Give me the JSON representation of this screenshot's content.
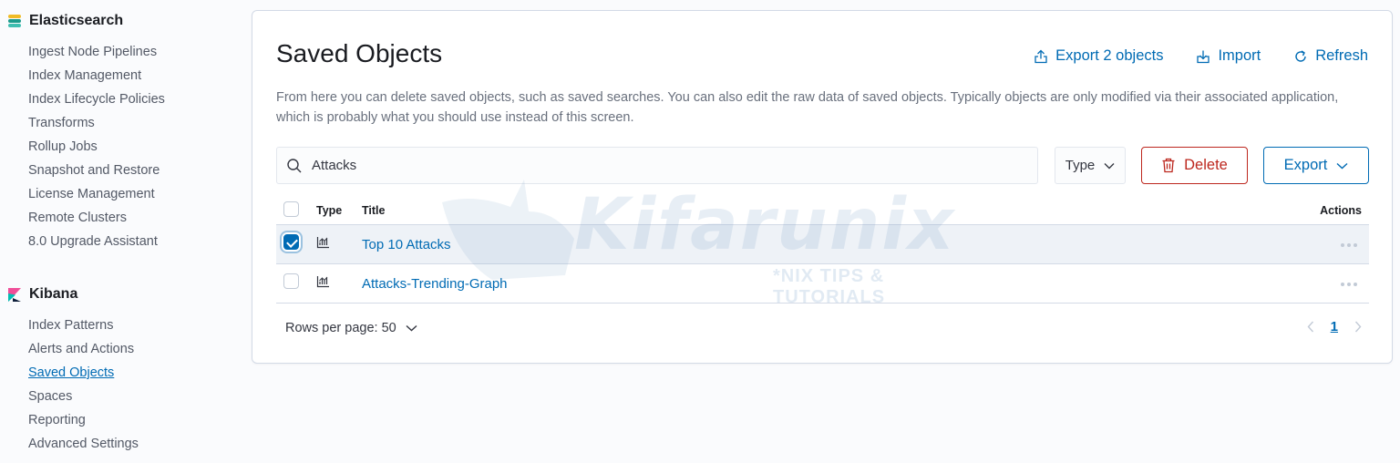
{
  "sidebar": {
    "elasticsearch": {
      "title": "Elasticsearch",
      "items": [
        "Ingest Node Pipelines",
        "Index Management",
        "Index Lifecycle Policies",
        "Transforms",
        "Rollup Jobs",
        "Snapshot and Restore",
        "License Management",
        "Remote Clusters",
        "8.0 Upgrade Assistant"
      ]
    },
    "kibana": {
      "title": "Kibana",
      "items": [
        "Index Patterns",
        "Alerts and Actions",
        "Saved Objects",
        "Spaces",
        "Reporting",
        "Advanced Settings"
      ],
      "active": "Saved Objects"
    }
  },
  "main": {
    "title": "Saved Objects",
    "actions": {
      "export_label": "Export 2 objects",
      "import_label": "Import",
      "refresh_label": "Refresh"
    },
    "description": "From here you can delete saved objects, such as saved searches. You can also edit the raw data of saved objects. Typically objects are only modified via their associated application, which is probably what you should use instead of this screen.",
    "search": {
      "value": "Attacks"
    },
    "type_filter_label": "Type",
    "delete_label": "Delete",
    "export_label": "Export",
    "table": {
      "headers": {
        "type": "Type",
        "title": "Title",
        "actions": "Actions"
      },
      "rows": [
        {
          "title": "Top 10 Attacks",
          "selected": true,
          "type_icon": "visualize-icon"
        },
        {
          "title": "Attacks-Trending-Graph",
          "selected": false,
          "type_icon": "visualize-icon"
        }
      ]
    },
    "footer": {
      "rows_per_page_label": "Rows per page: 50",
      "current_page": "1"
    }
  },
  "watermark": {
    "text": "Kifarunix",
    "subtitle": "*NIX TIPS & TUTORIALS"
  },
  "colors": {
    "link": "#006bb4",
    "danger": "#bd271e",
    "text": "#343741",
    "border": "#d3dae6"
  }
}
